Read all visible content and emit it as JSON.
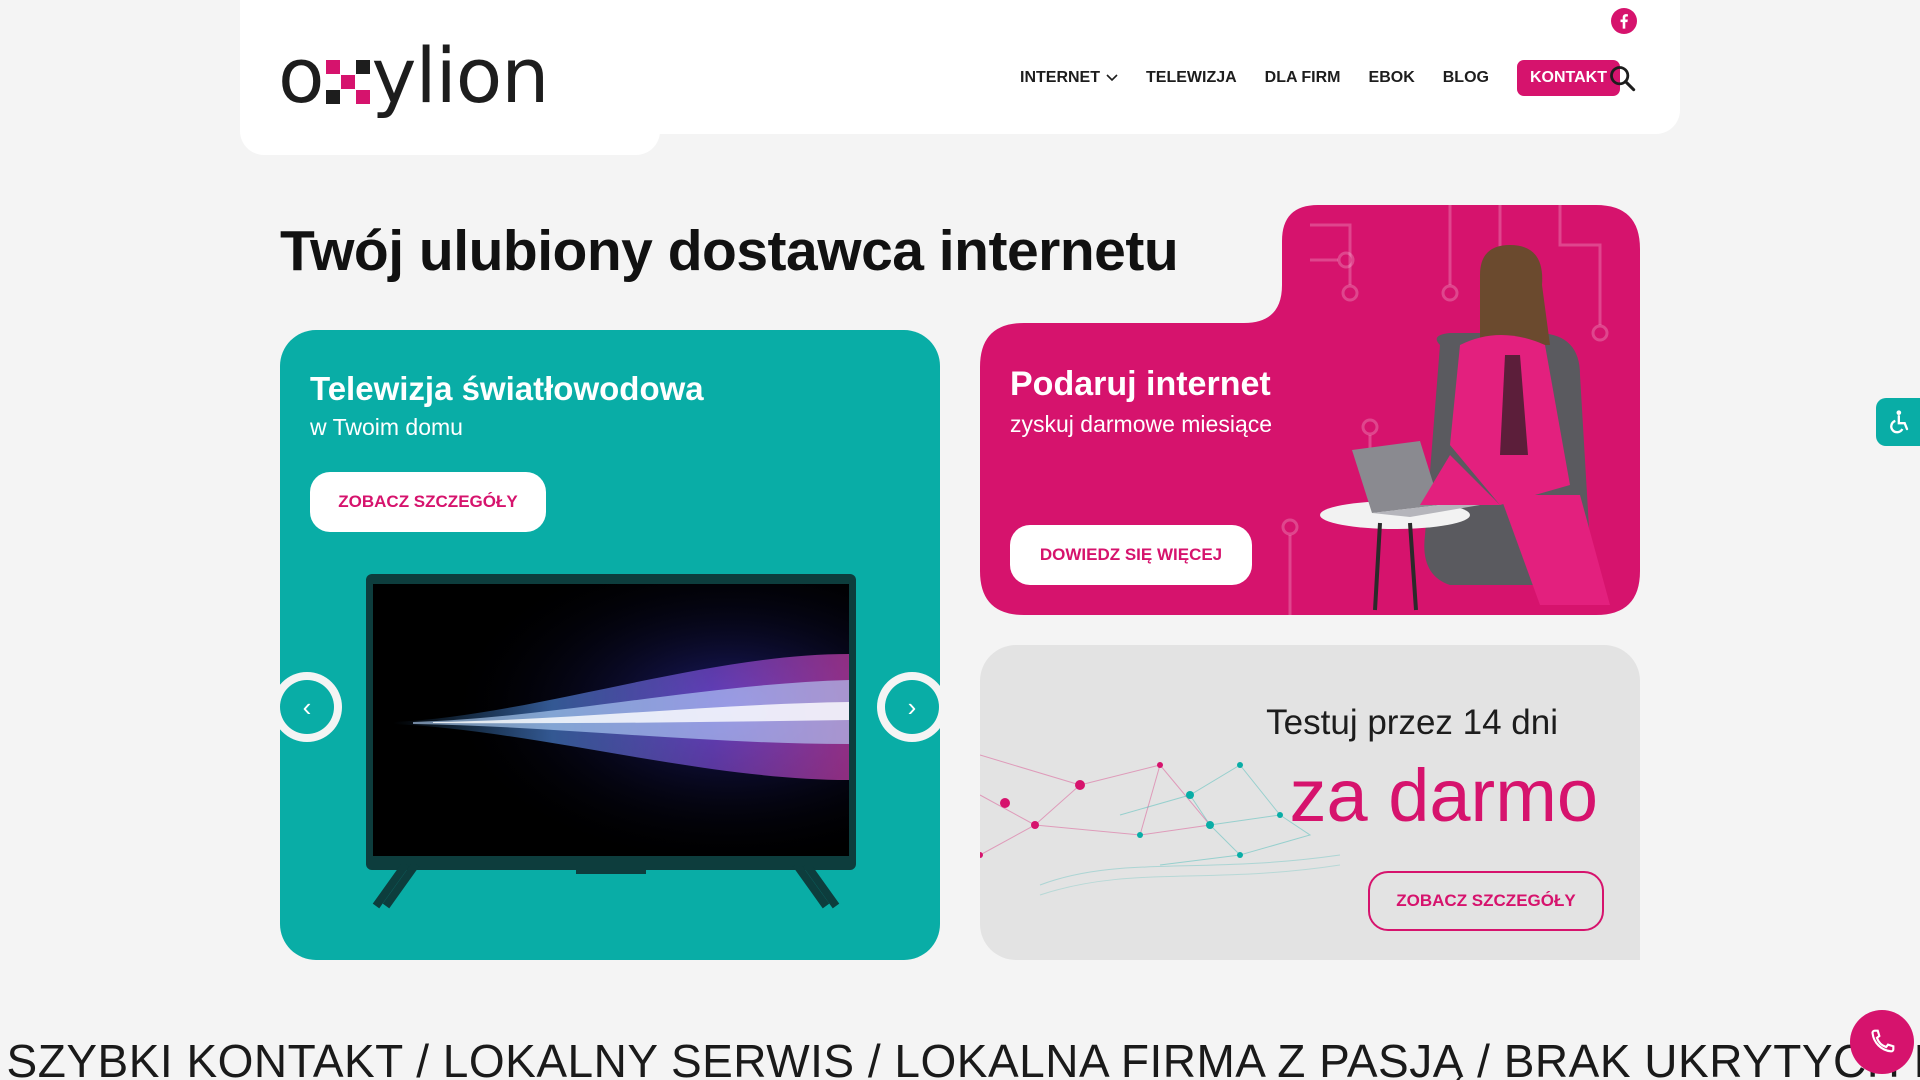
{
  "brand": {
    "name_left": "o",
    "name_right": "ylion",
    "accent": "#d6136d",
    "teal": "#09ada6"
  },
  "nav": {
    "items": [
      {
        "label": "INTERNET",
        "has_dropdown": true
      },
      {
        "label": "TELEWIZJA"
      },
      {
        "label": "DLA FIRM"
      },
      {
        "label": "EBOK"
      },
      {
        "label": "BLOG"
      }
    ],
    "contact_label": "KONTAKT"
  },
  "hero": {
    "title": "Twój ulubiony dostawca internetu"
  },
  "card_tv": {
    "title": "Telewizja światłowodowa",
    "subtitle": "w Twoim domu",
    "button": "ZOBACZ SZCZEGÓŁY",
    "prev_icon": "‹",
    "next_icon": "›"
  },
  "card_pink": {
    "title": "Podaruj internet",
    "subtitle": "zyskuj darmowe miesiące",
    "button": "DOWIEDZ SIĘ WIĘCEJ"
  },
  "card_grey": {
    "line1": "Testuj przez 14 dni",
    "line2": "za darmo",
    "button": "ZOBACZ SZCZEGÓŁY"
  },
  "ticker": {
    "text": "/ SZYBKI KONTAKT / LOKALNY SERWIS / LOKALNA FIRMA Z PASJĄ / BRAK UKRYTYCH KOS"
  }
}
